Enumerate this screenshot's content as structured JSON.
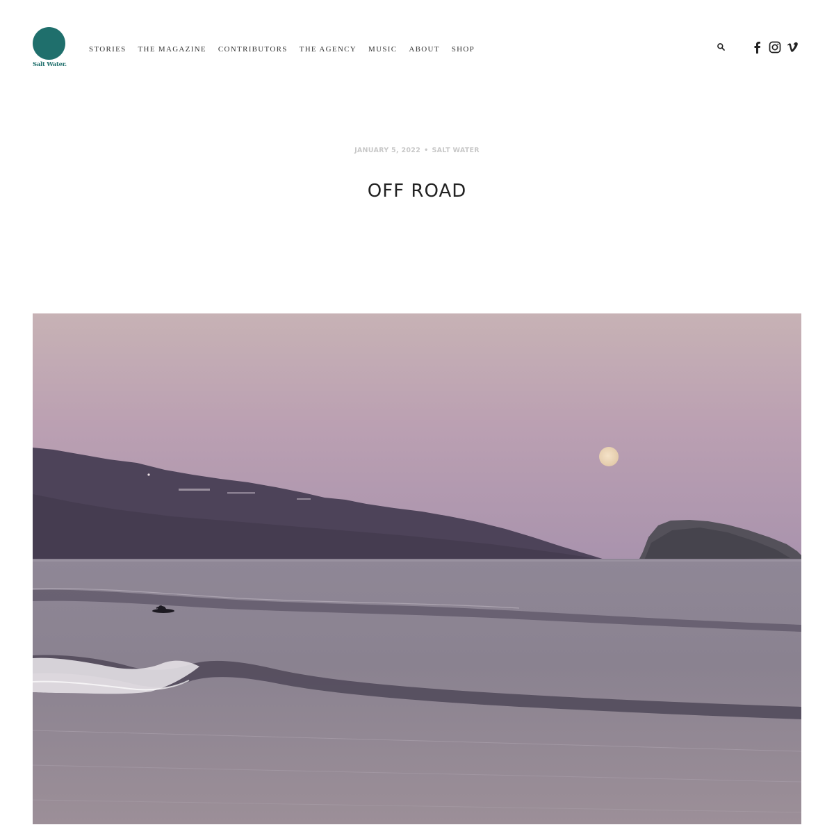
{
  "site": {
    "logo_text": "Salt Water.",
    "brand_color": "#1f6f6c"
  },
  "nav": {
    "items": [
      {
        "label": "STORIES"
      },
      {
        "label": "THE MAGAZINE"
      },
      {
        "label": "CONTRIBUTORS"
      },
      {
        "label": "THE AGENCY"
      },
      {
        "label": "MUSIC"
      },
      {
        "label": "ABOUT"
      },
      {
        "label": "SHOP"
      }
    ]
  },
  "header_icons": {
    "search": "search-icon",
    "social": [
      "facebook-icon",
      "instagram-icon",
      "vimeo-icon"
    ]
  },
  "post": {
    "date": "JANUARY 5, 2022",
    "separator": "•",
    "category": "SALT WATER",
    "title": "OFF ROAD",
    "hero_image": "twilight seascape with hills, rock islet, full moon and surfer"
  }
}
